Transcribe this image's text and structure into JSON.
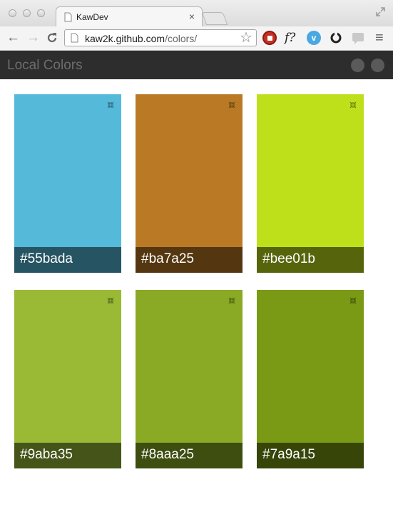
{
  "browser": {
    "tab_title": "KawDev",
    "url_host": "kaw2k.github.com",
    "url_path": "/colors/",
    "tab_close": "×",
    "back": "←",
    "forward": "→",
    "reload": "C",
    "star": "☆",
    "menu": "≡",
    "ext_f": "f?"
  },
  "app": {
    "title": "Local Colors"
  },
  "colors": [
    {
      "hex": "#55bada",
      "label": "#55bada"
    },
    {
      "hex": "#ba7a25",
      "label": "#ba7a25"
    },
    {
      "hex": "#bee01b",
      "label": "#bee01b"
    },
    {
      "hex": "#9aba35",
      "label": "#9aba35"
    },
    {
      "hex": "#8aaa25",
      "label": "#8aaa25"
    },
    {
      "hex": "#7a9a15",
      "label": "#7a9a15"
    }
  ]
}
